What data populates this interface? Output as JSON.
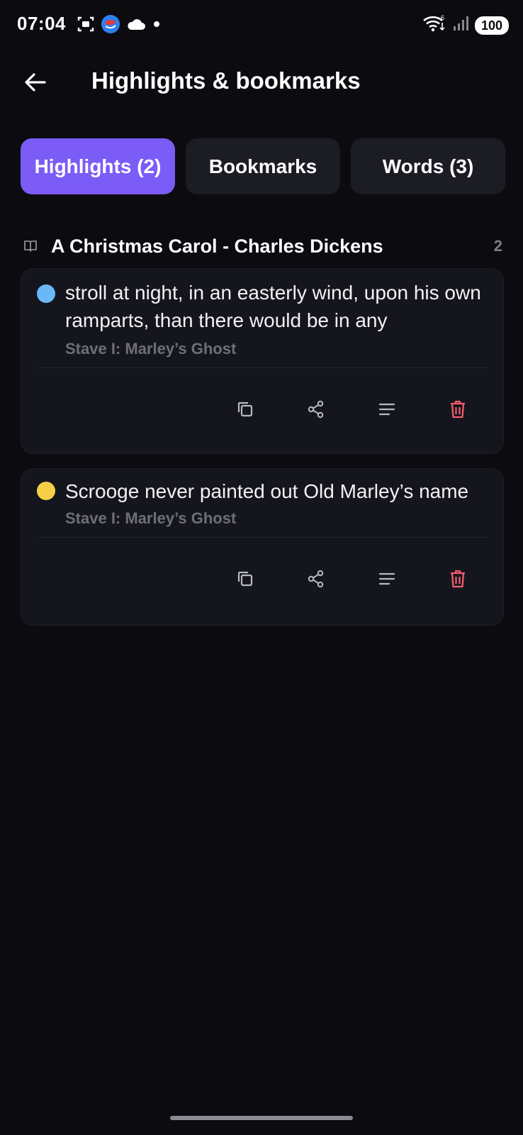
{
  "status_bar": {
    "time": "07:04",
    "battery": "100",
    "left_icons": [
      "screenshot-icon",
      "app-icon",
      "cloud-icon",
      "dot-icon"
    ],
    "right_icons": [
      "wifi-icon",
      "signal-icon",
      "battery-icon"
    ]
  },
  "header": {
    "title": "Highlights & bookmarks",
    "back_icon": "arrow-left-icon"
  },
  "tabs": [
    {
      "label": "Highlights (2)",
      "active": true
    },
    {
      "label": "Bookmarks",
      "active": false
    },
    {
      "label": "Words (3)",
      "active": false
    }
  ],
  "book": {
    "title": "A Christmas Carol - Charles Dickens",
    "count": "2",
    "icon": "book-open-icon"
  },
  "highlights": [
    {
      "text": "stroll at night, in an easterly wind, upon his own ramparts, than there would be in any",
      "chapter": "Stave I: Marley’s Ghost",
      "color": "#6ab8f7"
    },
    {
      "text": "Scrooge never painted out Old Marley’s name",
      "chapter": "Stave I: Marley’s Ghost",
      "color": "#f7cf46"
    }
  ],
  "actions": [
    "copy-icon",
    "share-icon",
    "notes-icon",
    "delete-icon"
  ],
  "colors": {
    "accent": "#7b5cf6",
    "background": "#0b0b10",
    "card": "#15161d",
    "delete": "#f25b6e"
  }
}
